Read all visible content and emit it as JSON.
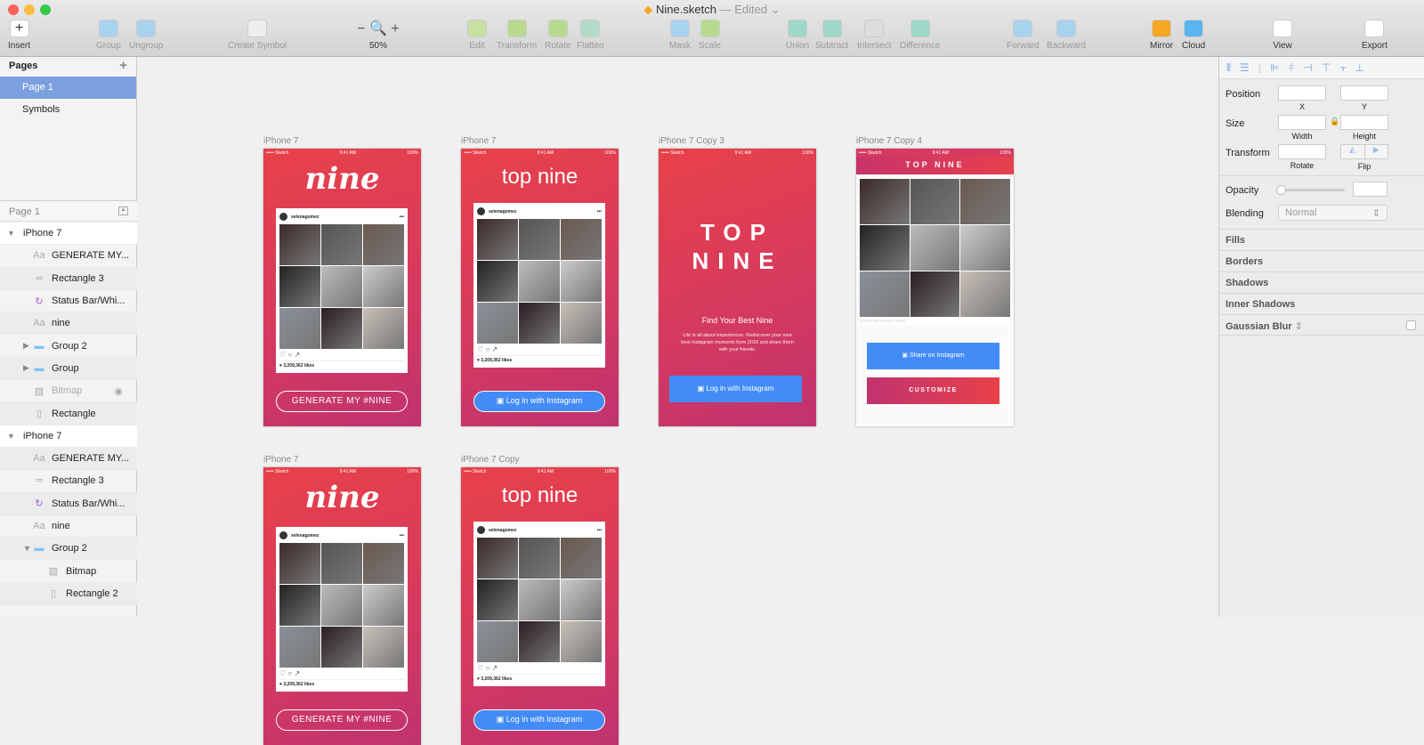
{
  "window": {
    "file": "Nine.sketch",
    "sep": "—",
    "status": "Edited"
  },
  "toolbar": {
    "insert": "Insert",
    "group": "Group",
    "ungroup": "Ungroup",
    "create_symbol": "Create Symbol",
    "zoom": "50%",
    "edit": "Edit",
    "transform": "Transform",
    "rotate": "Rotate",
    "flatten": "Flatten",
    "mask": "Mask",
    "scale": "Scale",
    "union": "Union",
    "subtract": "Subtract",
    "intersect": "Intersect",
    "difference": "Difference",
    "forward": "Forward",
    "backward": "Backward",
    "mirror": "Mirror",
    "cloud": "Cloud",
    "view": "View",
    "export": "Export"
  },
  "pages": {
    "title": "Pages",
    "items": [
      "Page 1",
      "Symbols"
    ],
    "selected": "Page 1"
  },
  "layers": {
    "header": "Page 1",
    "items": [
      {
        "name": "iPhone 7",
        "icon": "artboard",
        "level": 0
      },
      {
        "name": "GENERATE MY...",
        "icon": "text",
        "level": 1
      },
      {
        "name": "Rectangle 3",
        "icon": "line",
        "level": 1
      },
      {
        "name": "Status Bar/Whi...",
        "icon": "symbol",
        "level": 1
      },
      {
        "name": "nine",
        "icon": "text",
        "level": 1
      },
      {
        "name": "Group 2",
        "icon": "folder",
        "level": 1
      },
      {
        "name": "Group",
        "icon": "folder",
        "level": 1
      },
      {
        "name": "Bitmap",
        "icon": "bitmap",
        "level": 1,
        "hidden": true
      },
      {
        "name": "Rectangle",
        "icon": "rect",
        "level": 1
      },
      {
        "name": "iPhone 7",
        "icon": "artboard",
        "level": 0
      },
      {
        "name": "GENERATE MY...",
        "icon": "text",
        "level": 1
      },
      {
        "name": "Rectangle 3",
        "icon": "line",
        "level": 1
      },
      {
        "name": "Status Bar/Whi...",
        "icon": "symbol",
        "level": 1
      },
      {
        "name": "nine",
        "icon": "text",
        "level": 1
      },
      {
        "name": "Group 2",
        "icon": "folder",
        "level": 1,
        "open": true
      },
      {
        "name": "Bitmap",
        "icon": "bitmap",
        "level": 2
      },
      {
        "name": "Rectangle 2",
        "icon": "rect",
        "level": 2
      }
    ]
  },
  "inspector": {
    "position": "Position",
    "x": "X",
    "y": "Y",
    "size": "Size",
    "width": "Width",
    "height": "Height",
    "transform": "Transform",
    "rotate": "Rotate",
    "flip": "Flip",
    "opacity": "Opacity",
    "blending": "Blending",
    "blend_value": "Normal",
    "sections": [
      "Fills",
      "Borders",
      "Shadows",
      "Inner Shadows",
      "Gaussian Blur"
    ]
  },
  "statusbar": {
    "carrier": "••••• Sketch",
    "time": "9:41 AM",
    "battery": "100%"
  },
  "card": {
    "user": "selenagomez",
    "more": "•••",
    "likes": "♥ 3,209,362 likes"
  },
  "artboards": [
    {
      "label": "iPhone 7",
      "type": "nine",
      "logo": "nine",
      "button": "GENERATE MY #NINE"
    },
    {
      "label": "iPhone 7",
      "type": "topnine",
      "logo": "top nine",
      "button": "Log in with Instagram"
    },
    {
      "label": "iPhone 7 Copy 3",
      "type": "intro",
      "title1": "TOP",
      "title2": "NINE",
      "heading": "Find Your Best Nine",
      "body": "Life is all about experiences. Rediscover your nine best Instagram moments from 2016 and share them with your friends.",
      "button": "Log in with Instagram"
    },
    {
      "label": "iPhone 7 Copy 4",
      "type": "result",
      "header": "TOP NINE",
      "watermark": "MADE WITH BEST NINE",
      "button": "Share on Instagram",
      "button2": "CUSTOMIZE"
    },
    {
      "label": "iPhone 7",
      "type": "nine",
      "logo": "nine",
      "button": "GENERATE MY #NINE"
    },
    {
      "label": "iPhone 7 Copy",
      "type": "topnine",
      "logo": "top nine",
      "button": "Log in with Instagram"
    }
  ],
  "colors": {
    "accent": "#7c9fe0",
    "brand_red": "#e84149",
    "brand_purple": "#c0336f",
    "instagram_blue": "#438cf7"
  }
}
